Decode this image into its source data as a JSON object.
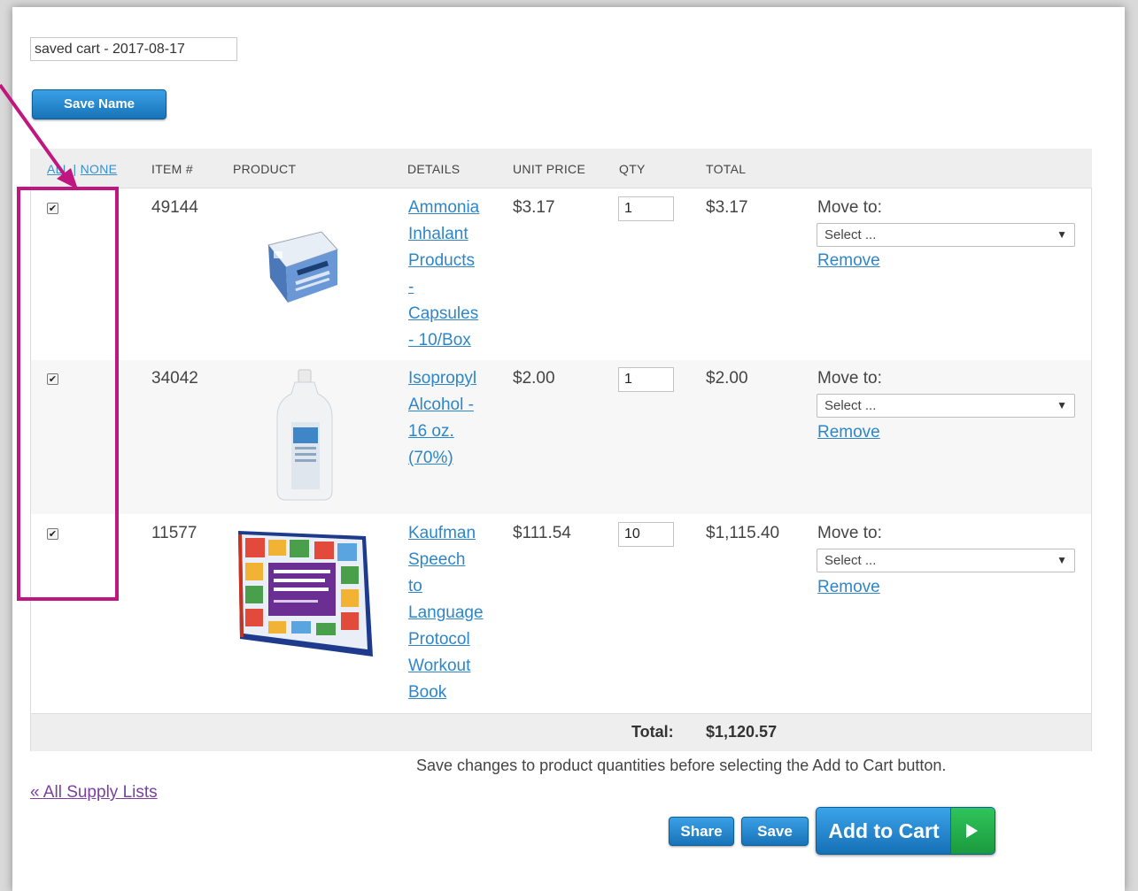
{
  "cart_name": "saved cart - 2017-08-17",
  "save_name_label": "Save Name",
  "headers": {
    "all": "ALL",
    "separator": "|",
    "none": "NONE",
    "item": "ITEM #",
    "product": "PRODUCT",
    "details": "DETAILS",
    "unit_price": "UNIT PRICE",
    "qty": "QTY",
    "total": "TOTAL"
  },
  "rows": [
    {
      "checked": true,
      "item": "49144",
      "details": [
        "Ammonia",
        "Inhalant",
        "Products",
        "-",
        "Capsules",
        "- 10/Box"
      ],
      "unit_price": "$3.17",
      "qty": "1",
      "total": "$3.17",
      "move_to_label": "Move to:",
      "select_value": "Select ...",
      "remove_label": "Remove"
    },
    {
      "checked": true,
      "item": "34042",
      "details": [
        "Isopropyl",
        "Alcohol -",
        "16 oz.",
        "(70%)"
      ],
      "unit_price": "$2.00",
      "qty": "1",
      "total": "$2.00",
      "move_to_label": "Move to:",
      "select_value": "Select ...",
      "remove_label": "Remove"
    },
    {
      "checked": true,
      "item": "11577",
      "details": [
        "Kaufman",
        "Speech",
        "to",
        "Language",
        "Protocol",
        "Workout",
        "Book"
      ],
      "unit_price": "$111.54",
      "qty": "10",
      "total": "$1,115.40",
      "move_to_label": "Move to:",
      "select_value": "Select ...",
      "remove_label": "Remove"
    }
  ],
  "total_label": "Total:",
  "total_value": "$1,120.57",
  "note": "Save changes to product quantities before selecting the Add to Cart button.",
  "back_link": "« All Supply Lists",
  "share_label": "Share",
  "save_label": "Save",
  "add_to_cart_label": "Add to Cart",
  "colors": {
    "accent_blue": "#1873b8",
    "link_blue": "#2e86c9",
    "highlight_pink": "#c0167f",
    "cart_green": "#1b9a3d"
  }
}
